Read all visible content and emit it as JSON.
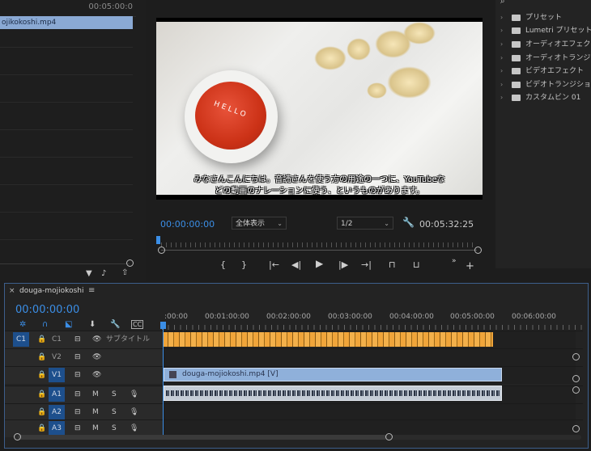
{
  "source_panel": {
    "timecode": "00:05:00:0",
    "clip_name": "ojikokoshi.mp4"
  },
  "program": {
    "subtitle_line1": "みなさんこんにちは。音読さんを使う方の用途の一つに、YouTubeな",
    "subtitle_line2": "どの動画のナレーションに使う、というものがあります。",
    "sauce_text": "HELLO",
    "current_timecode": "00:00:00:00",
    "zoom_label": "全体表示",
    "resolution_label": "1/2",
    "duration_timecode": "00:05:32:25"
  },
  "effects": {
    "items": [
      {
        "label": "プリセット",
        "icon": "preset-folder-icon"
      },
      {
        "label": "Lumetri プリセット",
        "icon": "preset-folder-icon"
      },
      {
        "label": "オーディオエフェクト",
        "icon": "folder-icon"
      },
      {
        "label": "オーディオトランジシ",
        "icon": "folder-icon"
      },
      {
        "label": "ビデオエフェクト",
        "icon": "folder-icon"
      },
      {
        "label": "ビデオトランジション",
        "icon": "folder-icon"
      },
      {
        "label": "カスタムビン 01",
        "icon": "folder-icon"
      }
    ]
  },
  "timeline": {
    "tab_label": "douga-mojiokoshi",
    "timecode": "00:00:00:00",
    "ruler_labels": [
      ":00:00",
      "00:01:00:00",
      "00:02:00:00",
      "00:03:00:00",
      "00:04:00:00",
      "00:05:00:00",
      "00:06:00:00"
    ],
    "tracks": {
      "c1": {
        "patch": "C1",
        "name": "C1",
        "label": "サブタイトル"
      },
      "v2": {
        "name": "V2"
      },
      "v1": {
        "name": "V1"
      },
      "a1": {
        "name": "A1",
        "m": "M",
        "s": "S"
      },
      "a2": {
        "name": "A2",
        "m": "M",
        "s": "S"
      },
      "a3": {
        "name": "A3",
        "m": "M",
        "s": "S"
      }
    },
    "v1_clip_label": "douga-mojiokoshi.mp4 [V]"
  },
  "colors": {
    "accent": "#3b8ee6",
    "caption_clip": "#f0a53a",
    "video_clip": "#8fb0da"
  }
}
